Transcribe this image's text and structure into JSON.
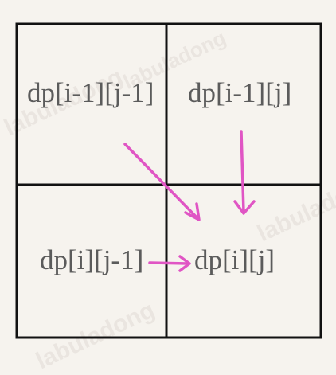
{
  "cells": {
    "top_left": "dp[i-1][j-1]",
    "top_right": "dp[i-1][j]",
    "bottom_left": "dp[i][j-1]",
    "bottom_right": "dp[i][j]"
  },
  "watermark": "labuladong",
  "colors": {
    "grid": "#111111",
    "arrow": "#e055c4",
    "text": "#5b5b5b",
    "background": "#f6f3ee"
  }
}
